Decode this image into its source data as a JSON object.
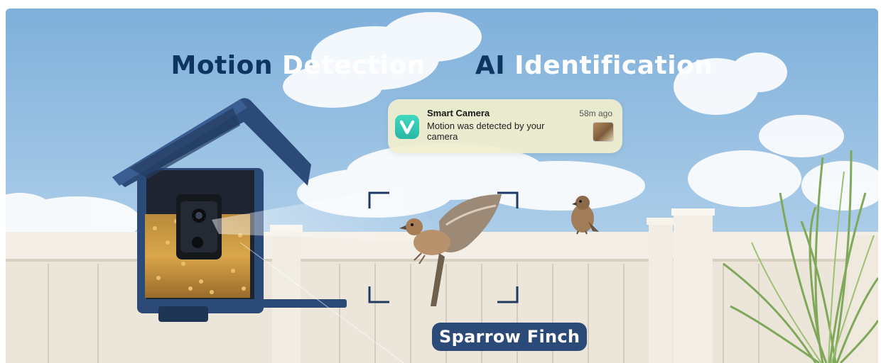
{
  "headline": {
    "part1": "Motion",
    "part2": "Detection",
    "part3": "AI",
    "part4": "Identification"
  },
  "notification": {
    "app_icon": "v-logo-icon",
    "app_name": "Smart Camera",
    "time_ago": "58m ago",
    "message": "Motion was detected by your camera"
  },
  "species_label": "Sparrow Finch",
  "colors": {
    "headline_dark": "#0d3560",
    "headline_light": "#ffffff",
    "feeder_blue": "#2b4a78",
    "label_bg": "#2b4a78",
    "app_icon": "#33c8b2"
  }
}
